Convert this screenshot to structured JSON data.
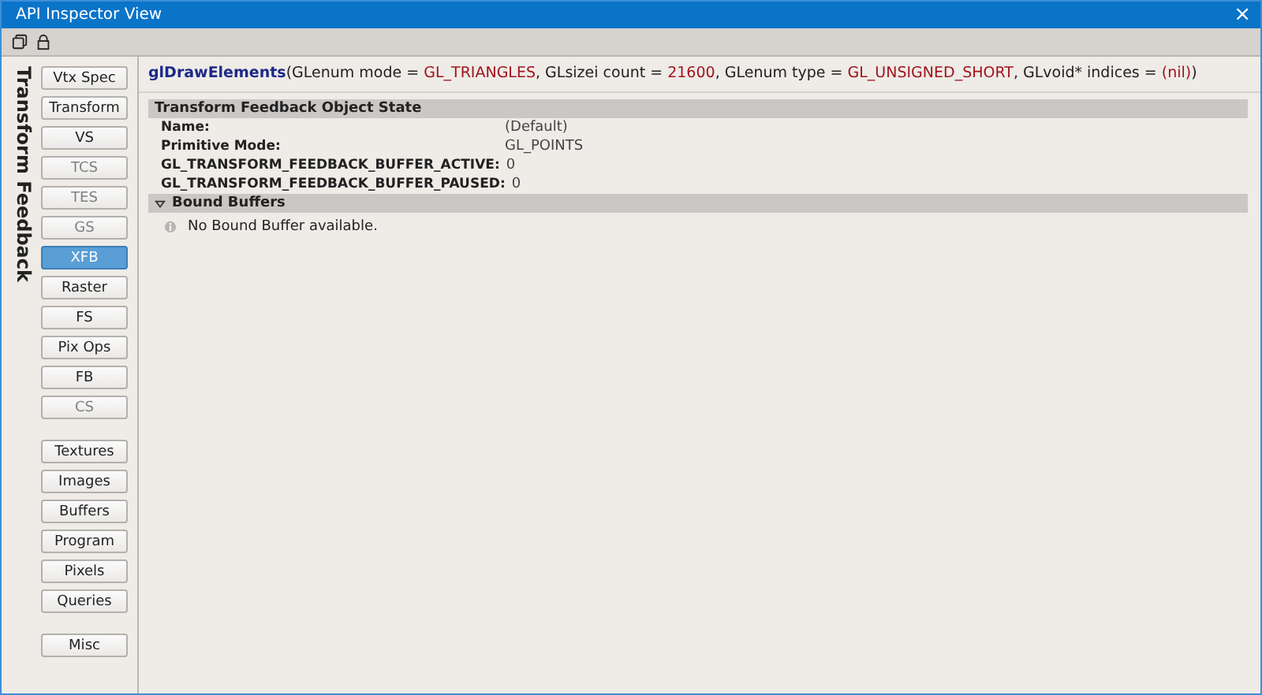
{
  "window": {
    "title": "API Inspector View",
    "close": "×"
  },
  "sidebar": {
    "title": "Transform Feedback",
    "groups": [
      [
        {
          "label": "Vtx Spec",
          "selected": false,
          "disabled": false
        },
        {
          "label": "Transform",
          "selected": false,
          "disabled": false
        },
        {
          "label": "VS",
          "selected": false,
          "disabled": false
        },
        {
          "label": "TCS",
          "selected": false,
          "disabled": true
        },
        {
          "label": "TES",
          "selected": false,
          "disabled": true
        },
        {
          "label": "GS",
          "selected": false,
          "disabled": true
        },
        {
          "label": "XFB",
          "selected": true,
          "disabled": false
        },
        {
          "label": "Raster",
          "selected": false,
          "disabled": false
        },
        {
          "label": "FS",
          "selected": false,
          "disabled": false
        },
        {
          "label": "Pix Ops",
          "selected": false,
          "disabled": false
        },
        {
          "label": "FB",
          "selected": false,
          "disabled": false
        },
        {
          "label": "CS",
          "selected": false,
          "disabled": true
        }
      ],
      [
        {
          "label": "Textures",
          "selected": false,
          "disabled": false
        },
        {
          "label": "Images",
          "selected": false,
          "disabled": false
        },
        {
          "label": "Buffers",
          "selected": false,
          "disabled": false
        },
        {
          "label": "Program",
          "selected": false,
          "disabled": false
        },
        {
          "label": "Pixels",
          "selected": false,
          "disabled": false
        },
        {
          "label": "Queries",
          "selected": false,
          "disabled": false
        }
      ],
      [
        {
          "label": "Misc",
          "selected": false,
          "disabled": false
        }
      ]
    ]
  },
  "call": {
    "function": "glDrawElements",
    "segments": [
      {
        "kind": "text",
        "text": "(GLenum mode = "
      },
      {
        "kind": "value",
        "text": "GL_TRIANGLES"
      },
      {
        "kind": "text",
        "text": ", GLsizei count = "
      },
      {
        "kind": "value",
        "text": "21600"
      },
      {
        "kind": "text",
        "text": ", GLenum type = "
      },
      {
        "kind": "value",
        "text": "GL_UNSIGNED_SHORT"
      },
      {
        "kind": "text",
        "text": ", GLvoid* indices = "
      },
      {
        "kind": "value",
        "text": "(nil)"
      },
      {
        "kind": "text",
        "text": ")"
      }
    ]
  },
  "sections": [
    {
      "title": "Transform Feedback Object State",
      "expanded": true,
      "collapsible": false,
      "rows": [
        {
          "name": "Name:",
          "value": "(Default)"
        },
        {
          "name": "Primitive Mode:",
          "value": "GL_POINTS"
        },
        {
          "name": "GL_TRANSFORM_FEEDBACK_BUFFER_ACTIVE:",
          "value": "0"
        },
        {
          "name": "GL_TRANSFORM_FEEDBACK_BUFFER_PAUSED:",
          "value": "0"
        }
      ]
    },
    {
      "title": "Bound Buffers",
      "expanded": true,
      "collapsible": true,
      "message": "No Bound Buffer available."
    }
  ]
}
